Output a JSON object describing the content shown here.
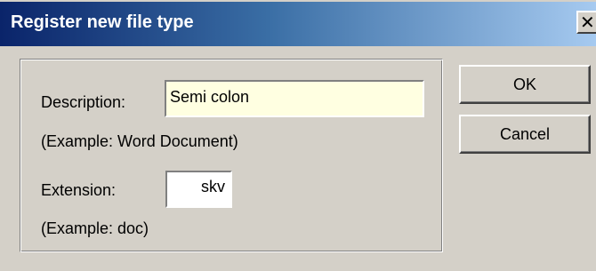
{
  "window": {
    "title": "Register new file type",
    "close_symbol": "✕"
  },
  "form": {
    "description_label": "Description:",
    "description_value": "Semi colon",
    "description_example": "(Example: Word Document)",
    "extension_label": "Extension:",
    "extension_value": "skv",
    "extension_example": "(Example: doc)"
  },
  "buttons": {
    "ok_label": "OK",
    "cancel_label": "Cancel"
  },
  "colors": {
    "title_gradient_start": "#0a246a",
    "title_gradient_end": "#a6caf0",
    "dialog_background": "#d4d0c8",
    "description_field_background": "#ffffe1"
  }
}
